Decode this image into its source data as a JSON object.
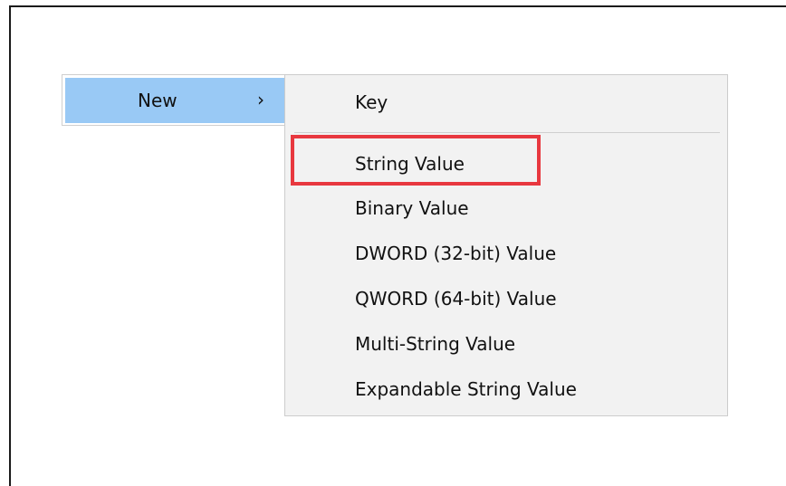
{
  "parent_menu": {
    "item_label": "New",
    "chevron": "›"
  },
  "submenu": {
    "items": [
      {
        "label": "Key"
      },
      {
        "label": "String Value"
      },
      {
        "label": "Binary Value"
      },
      {
        "label": "DWORD (32-bit) Value"
      },
      {
        "label": "QWORD (64-bit) Value"
      },
      {
        "label": "Multi-String Value"
      },
      {
        "label": "Expandable String Value"
      }
    ]
  },
  "colors": {
    "hover_blue": "#99c9f5",
    "menu_bg": "#f2f2f2",
    "highlight_red": "#e8383f"
  }
}
